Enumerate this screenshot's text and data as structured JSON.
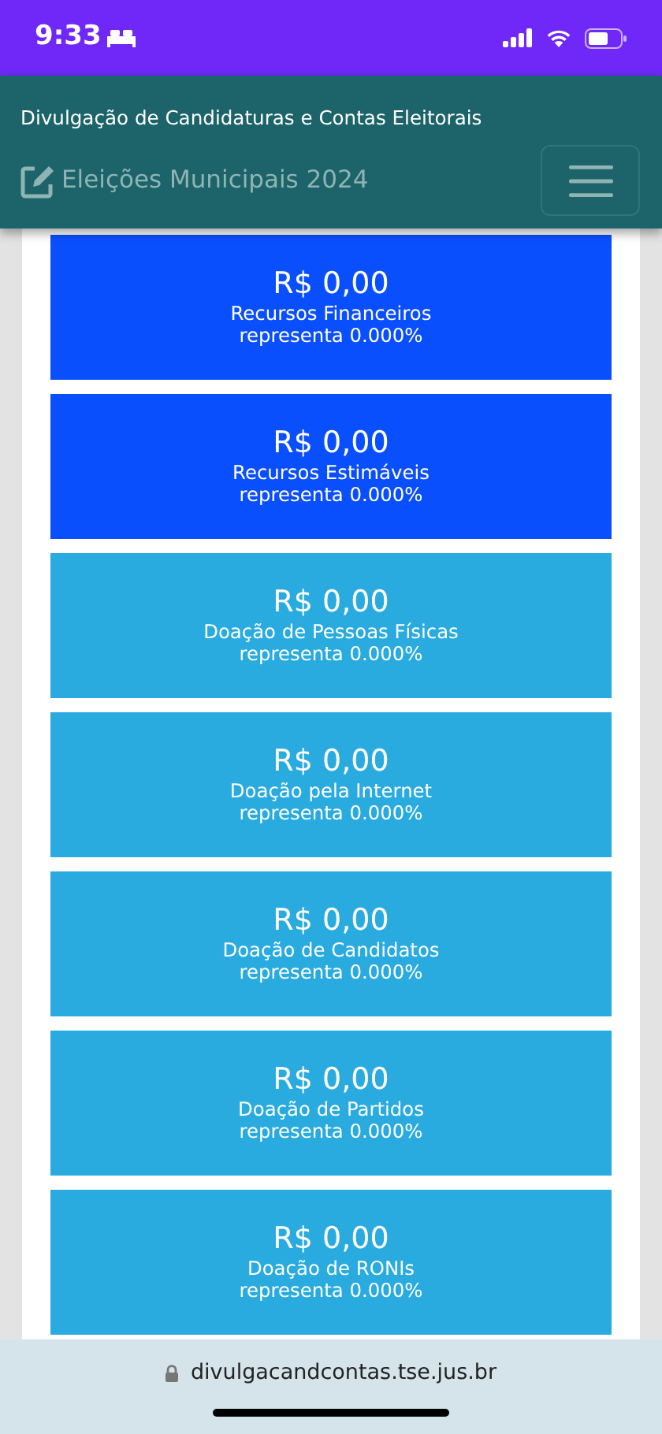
{
  "status_bar": {
    "time": "9:33"
  },
  "header": {
    "site_title": "Divulgação de Candidaturas e Contas Eleitorais",
    "election": "Eleições Municipais 2024"
  },
  "cards": [
    {
      "amount": "R$ 0,00",
      "label": "Recursos Financeiros",
      "share": "representa 0.000%",
      "color": "#0a4ffe"
    },
    {
      "amount": "R$ 0,00",
      "label": "Recursos Estimáveis",
      "share": "representa 0.000%",
      "color": "#0a4ffe"
    },
    {
      "amount": "R$ 0,00",
      "label": "Doação de Pessoas Físicas",
      "share": "representa 0.000%",
      "color": "#29abe0"
    },
    {
      "amount": "R$ 0,00",
      "label": "Doação pela Internet",
      "share": "representa 0.000%",
      "color": "#29abe0"
    },
    {
      "amount": "R$ 0,00",
      "label": "Doação de Candidatos",
      "share": "representa 0.000%",
      "color": "#29abe0"
    },
    {
      "amount": "R$ 0,00",
      "label": "Doação de Partidos",
      "share": "representa 0.000%",
      "color": "#29abe0"
    },
    {
      "amount": "R$ 0,00",
      "label": "Doação de RONIs",
      "share": "representa 0.000%",
      "color": "#29abe0"
    }
  ],
  "browser_bar": {
    "url": "divulgacandcontas.tse.jus.br"
  }
}
